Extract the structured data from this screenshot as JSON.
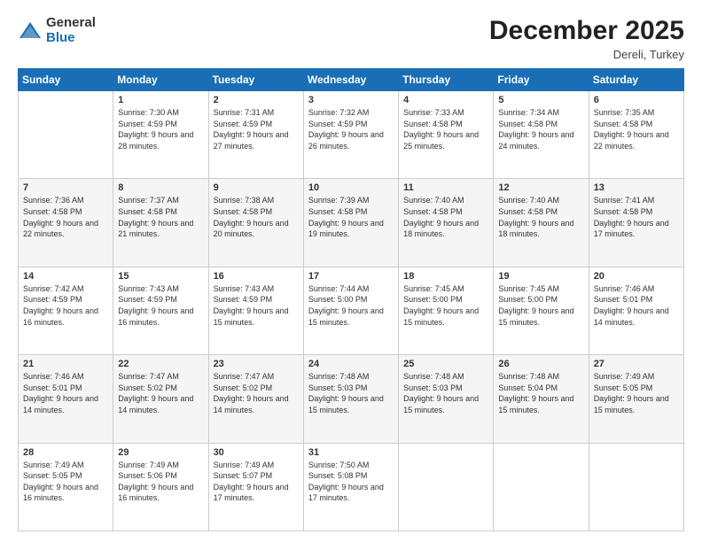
{
  "header": {
    "logo_general": "General",
    "logo_blue": "Blue",
    "month_title": "December 2025",
    "location": "Dereli, Turkey"
  },
  "days_of_week": [
    "Sunday",
    "Monday",
    "Tuesday",
    "Wednesday",
    "Thursday",
    "Friday",
    "Saturday"
  ],
  "weeks": [
    {
      "shaded": false,
      "days": [
        {
          "num": "",
          "sunrise": "",
          "sunset": "",
          "daylight": "",
          "empty": true
        },
        {
          "num": "1",
          "sunrise": "Sunrise: 7:30 AM",
          "sunset": "Sunset: 4:59 PM",
          "daylight": "Daylight: 9 hours and 28 minutes."
        },
        {
          "num": "2",
          "sunrise": "Sunrise: 7:31 AM",
          "sunset": "Sunset: 4:59 PM",
          "daylight": "Daylight: 9 hours and 27 minutes."
        },
        {
          "num": "3",
          "sunrise": "Sunrise: 7:32 AM",
          "sunset": "Sunset: 4:59 PM",
          "daylight": "Daylight: 9 hours and 26 minutes."
        },
        {
          "num": "4",
          "sunrise": "Sunrise: 7:33 AM",
          "sunset": "Sunset: 4:58 PM",
          "daylight": "Daylight: 9 hours and 25 minutes."
        },
        {
          "num": "5",
          "sunrise": "Sunrise: 7:34 AM",
          "sunset": "Sunset: 4:58 PM",
          "daylight": "Daylight: 9 hours and 24 minutes."
        },
        {
          "num": "6",
          "sunrise": "Sunrise: 7:35 AM",
          "sunset": "Sunset: 4:58 PM",
          "daylight": "Daylight: 9 hours and 22 minutes."
        }
      ]
    },
    {
      "shaded": true,
      "days": [
        {
          "num": "7",
          "sunrise": "Sunrise: 7:36 AM",
          "sunset": "Sunset: 4:58 PM",
          "daylight": "Daylight: 9 hours and 22 minutes."
        },
        {
          "num": "8",
          "sunrise": "Sunrise: 7:37 AM",
          "sunset": "Sunset: 4:58 PM",
          "daylight": "Daylight: 9 hours and 21 minutes."
        },
        {
          "num": "9",
          "sunrise": "Sunrise: 7:38 AM",
          "sunset": "Sunset: 4:58 PM",
          "daylight": "Daylight: 9 hours and 20 minutes."
        },
        {
          "num": "10",
          "sunrise": "Sunrise: 7:39 AM",
          "sunset": "Sunset: 4:58 PM",
          "daylight": "Daylight: 9 hours and 19 minutes."
        },
        {
          "num": "11",
          "sunrise": "Sunrise: 7:40 AM",
          "sunset": "Sunset: 4:58 PM",
          "daylight": "Daylight: 9 hours and 18 minutes."
        },
        {
          "num": "12",
          "sunrise": "Sunrise: 7:40 AM",
          "sunset": "Sunset: 4:58 PM",
          "daylight": "Daylight: 9 hours and 18 minutes."
        },
        {
          "num": "13",
          "sunrise": "Sunrise: 7:41 AM",
          "sunset": "Sunset: 4:58 PM",
          "daylight": "Daylight: 9 hours and 17 minutes."
        }
      ]
    },
    {
      "shaded": false,
      "days": [
        {
          "num": "14",
          "sunrise": "Sunrise: 7:42 AM",
          "sunset": "Sunset: 4:59 PM",
          "daylight": "Daylight: 9 hours and 16 minutes."
        },
        {
          "num": "15",
          "sunrise": "Sunrise: 7:43 AM",
          "sunset": "Sunset: 4:59 PM",
          "daylight": "Daylight: 9 hours and 16 minutes."
        },
        {
          "num": "16",
          "sunrise": "Sunrise: 7:43 AM",
          "sunset": "Sunset: 4:59 PM",
          "daylight": "Daylight: 9 hours and 15 minutes."
        },
        {
          "num": "17",
          "sunrise": "Sunrise: 7:44 AM",
          "sunset": "Sunset: 5:00 PM",
          "daylight": "Daylight: 9 hours and 15 minutes."
        },
        {
          "num": "18",
          "sunrise": "Sunrise: 7:45 AM",
          "sunset": "Sunset: 5:00 PM",
          "daylight": "Daylight: 9 hours and 15 minutes."
        },
        {
          "num": "19",
          "sunrise": "Sunrise: 7:45 AM",
          "sunset": "Sunset: 5:00 PM",
          "daylight": "Daylight: 9 hours and 15 minutes."
        },
        {
          "num": "20",
          "sunrise": "Sunrise: 7:46 AM",
          "sunset": "Sunset: 5:01 PM",
          "daylight": "Daylight: 9 hours and 14 minutes."
        }
      ]
    },
    {
      "shaded": true,
      "days": [
        {
          "num": "21",
          "sunrise": "Sunrise: 7:46 AM",
          "sunset": "Sunset: 5:01 PM",
          "daylight": "Daylight: 9 hours and 14 minutes."
        },
        {
          "num": "22",
          "sunrise": "Sunrise: 7:47 AM",
          "sunset": "Sunset: 5:02 PM",
          "daylight": "Daylight: 9 hours and 14 minutes."
        },
        {
          "num": "23",
          "sunrise": "Sunrise: 7:47 AM",
          "sunset": "Sunset: 5:02 PM",
          "daylight": "Daylight: 9 hours and 14 minutes."
        },
        {
          "num": "24",
          "sunrise": "Sunrise: 7:48 AM",
          "sunset": "Sunset: 5:03 PM",
          "daylight": "Daylight: 9 hours and 15 minutes."
        },
        {
          "num": "25",
          "sunrise": "Sunrise: 7:48 AM",
          "sunset": "Sunset: 5:03 PM",
          "daylight": "Daylight: 9 hours and 15 minutes."
        },
        {
          "num": "26",
          "sunrise": "Sunrise: 7:48 AM",
          "sunset": "Sunset: 5:04 PM",
          "daylight": "Daylight: 9 hours and 15 minutes."
        },
        {
          "num": "27",
          "sunrise": "Sunrise: 7:49 AM",
          "sunset": "Sunset: 5:05 PM",
          "daylight": "Daylight: 9 hours and 15 minutes."
        }
      ]
    },
    {
      "shaded": false,
      "days": [
        {
          "num": "28",
          "sunrise": "Sunrise: 7:49 AM",
          "sunset": "Sunset: 5:05 PM",
          "daylight": "Daylight: 9 hours and 16 minutes."
        },
        {
          "num": "29",
          "sunrise": "Sunrise: 7:49 AM",
          "sunset": "Sunset: 5:06 PM",
          "daylight": "Daylight: 9 hours and 16 minutes."
        },
        {
          "num": "30",
          "sunrise": "Sunrise: 7:49 AM",
          "sunset": "Sunset: 5:07 PM",
          "daylight": "Daylight: 9 hours and 17 minutes."
        },
        {
          "num": "31",
          "sunrise": "Sunrise: 7:50 AM",
          "sunset": "Sunset: 5:08 PM",
          "daylight": "Daylight: 9 hours and 17 minutes."
        },
        {
          "num": "",
          "sunrise": "",
          "sunset": "",
          "daylight": "",
          "empty": true
        },
        {
          "num": "",
          "sunrise": "",
          "sunset": "",
          "daylight": "",
          "empty": true
        },
        {
          "num": "",
          "sunrise": "",
          "sunset": "",
          "daylight": "",
          "empty": true
        }
      ]
    }
  ]
}
